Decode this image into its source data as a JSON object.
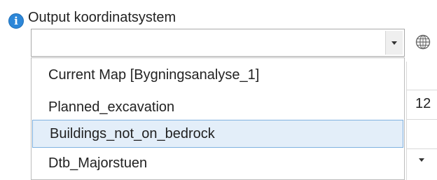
{
  "field": {
    "label": "Output koordinatsystem",
    "value": ""
  },
  "dropdown": {
    "options": [
      "Current Map [Bygningsanalyse_1]",
      "Planned_excavation",
      "Buildings_not_on_bedrock",
      "Dtb_Majorstuen"
    ],
    "highlighted_index": 2
  },
  "background": {
    "partial_value": "12"
  },
  "colors": {
    "info_icon": "#2d87d8",
    "highlight_bg": "#e3eef9",
    "highlight_border": "#7fb1e0"
  },
  "icons": {
    "info": "info-icon",
    "globe": "globe-icon",
    "dropdown": "chevron-down-icon"
  }
}
